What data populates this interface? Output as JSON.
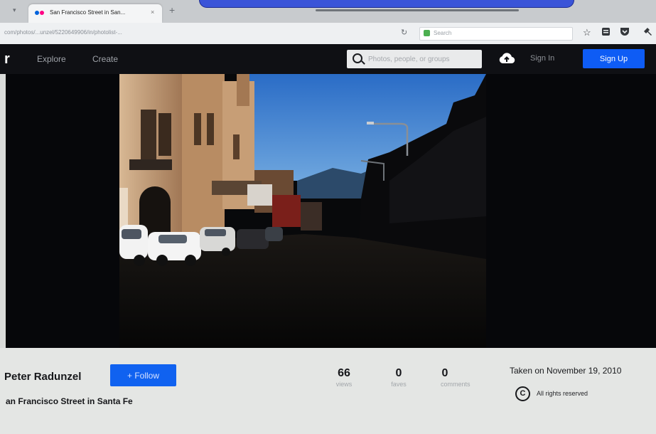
{
  "browser": {
    "tab_title": "San Francisco Street in San...",
    "tab_close": "×",
    "new_tab": "+",
    "url": "com/photos/...unzel/5220649906/in/photolist-...",
    "search_placeholder": "Search"
  },
  "header": {
    "logo": "r",
    "nav": [
      "Explore",
      "Create"
    ],
    "search_placeholder": "Photos, people, or groups",
    "signin_label": "Sign In",
    "signup_label": "Sign Up"
  },
  "photo": {
    "owner": "Peter Radunzel",
    "follow_label": "+ Follow",
    "title": "an Francisco Street in Santa Fe",
    "stats": [
      {
        "value": "66",
        "label": "views"
      },
      {
        "value": "0",
        "label": "faves"
      },
      {
        "value": "0",
        "label": "comments"
      }
    ],
    "taken": "Taken on November 19, 2010",
    "license_icon": "C",
    "license": "All rights reserved"
  },
  "colors": {
    "signup": "#0e5cf5",
    "follow": "#1062f0",
    "header_bg": "#0f1014",
    "stage_bg": "#06070a",
    "sky": "#2f73c8"
  },
  "icons": [
    "star-icon",
    "reading-list-icon",
    "pocket-icon",
    "upload-cloud-icon",
    "search-icon",
    "creative-commons-icon"
  ]
}
